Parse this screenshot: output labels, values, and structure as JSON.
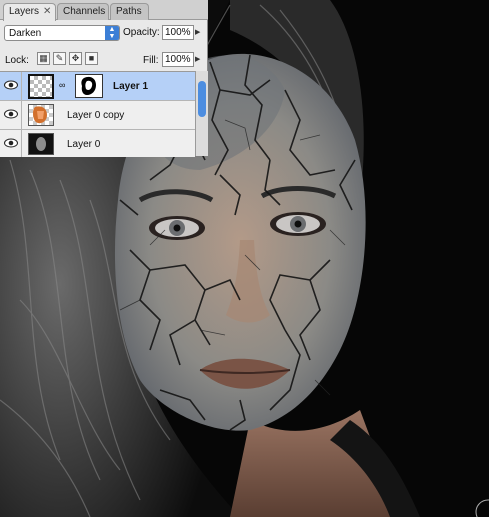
{
  "tabs": [
    {
      "label": "Layers",
      "active": true
    },
    {
      "label": "Channels",
      "active": false
    },
    {
      "label": "Paths",
      "active": false
    }
  ],
  "blend_mode": "Darken",
  "opacity": {
    "label": "Opacity:",
    "value": "100%"
  },
  "lock": {
    "label": "Lock:"
  },
  "fill": {
    "label": "Fill:",
    "value": "100%"
  },
  "layers": [
    {
      "name": "Layer 1",
      "selected": true,
      "visible": true,
      "has_mask": true
    },
    {
      "name": "Layer 0 copy",
      "selected": false,
      "visible": true,
      "has_mask": false
    },
    {
      "name": "Layer 0",
      "selected": false,
      "visible": true,
      "has_mask": false
    }
  ],
  "colors": {
    "accent": "#3c7fd6",
    "selection": "#b5d0f7",
    "skin": "#a87e68",
    "crack": "#1a1a1a"
  }
}
